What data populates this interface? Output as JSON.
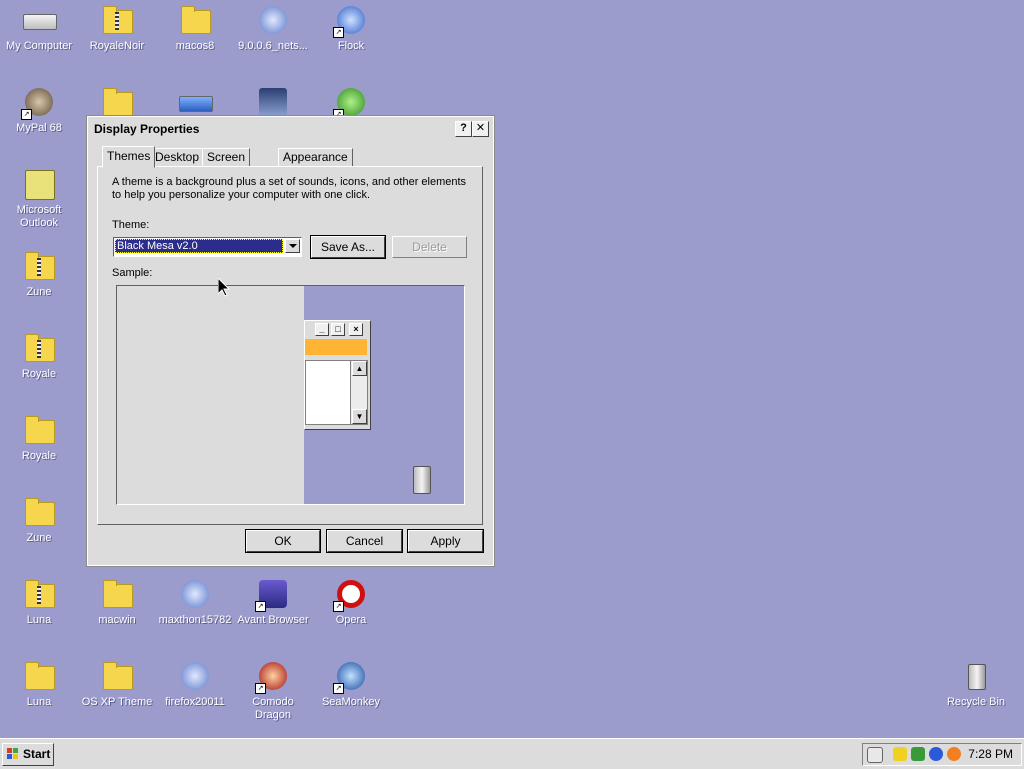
{
  "desktop": {
    "icons": [
      {
        "label": "My Computer"
      },
      {
        "label": "RoyaleNoir"
      },
      {
        "label": "macos8"
      },
      {
        "label": "9.0.0.6_nets..."
      },
      {
        "label": "Flock"
      },
      {
        "label": "MyPal 68"
      },
      {
        "label": "Microsoft Outlook"
      },
      {
        "label": "Zune"
      },
      {
        "label": "Royale"
      },
      {
        "label": "Royale"
      },
      {
        "label": "Zune"
      },
      {
        "label": "Luna"
      },
      {
        "label": "macwin"
      },
      {
        "label": "maxthon15782"
      },
      {
        "label": "Avant Browser"
      },
      {
        "label": "Opera"
      },
      {
        "label": "Luna"
      },
      {
        "label": "OS XP Theme"
      },
      {
        "label": "firefox20011"
      },
      {
        "label": "Comodo Dragon"
      },
      {
        "label": "SeaMonkey"
      },
      {
        "label": "Recycle Bin"
      }
    ]
  },
  "dialog": {
    "title": "Display Properties",
    "help_btn": "?",
    "close_btn": "✕",
    "tabs": [
      "Themes",
      "Desktop",
      "Screen Saver",
      "Appearance"
    ],
    "description": "A theme is a background plus a set of sounds, icons, and other elements to help you personalize your computer with one click.",
    "theme_label": "Theme:",
    "theme_value": "Black Mesa v2.0",
    "save_as": "Save As...",
    "delete": "Delete",
    "sample_label": "Sample:",
    "ok": "OK",
    "cancel": "Cancel",
    "apply": "Apply"
  },
  "taskbar": {
    "start": "Start",
    "clock": "7:28 PM"
  },
  "colors": {
    "desktop": "#9c9ccc",
    "selection": "#2c2c8c",
    "sample_caption": "#ffb433"
  }
}
